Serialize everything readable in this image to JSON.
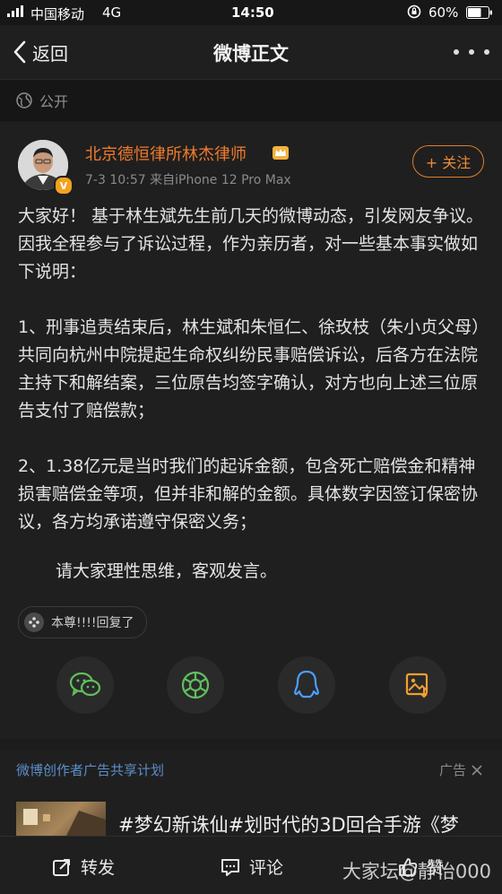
{
  "status": {
    "carrier": "中国移动",
    "network": "4G",
    "time": "14:50",
    "battery": "60%"
  },
  "nav": {
    "back_label": "返回",
    "title": "微博正文"
  },
  "visibility": {
    "label": "公开"
  },
  "post": {
    "author": "北京德恒律所林杰律师",
    "meta": "7-3 10:57  来自iPhone 12 Pro Max",
    "follow_label": "+ 关注",
    "paragraphs": [
      "大家好！ 基于林生斌先生前几天的微博动态，引发网友争议。因我全程参与了诉讼过程，作为亲历者，对一些基本事实做如下说明：",
      "1、刑事追责结束后，林生斌和朱恒仁、徐玫枝（朱小贞父母）共同向杭州中院提起生命权纠纷民事赔偿诉讼，后各方在法院主持下和解结案，三位原告均签字确认，对方也向上述三位原告支付了赔偿款；",
      "2、1.38亿元是当时我们的起诉金额，包含死亡赔偿金和精神损害赔偿金等项，但并非和解的金额。具体数字因签订保密协议，各方均承诺遵守保密义务；",
      "请大家理性思维，客观发言。"
    ],
    "reply_text": "本尊!!!!回复了"
  },
  "share": [
    "wechat-icon",
    "moments-icon",
    "qq-icon",
    "save-image-icon"
  ],
  "ad": {
    "plan_label": "微博创作者广告共享计划",
    "tag_label": "广告",
    "title": "#梦幻新诛仙#划时代的3D回合手游《梦"
  },
  "tabbar": {
    "repost": "转发",
    "comment": "评论",
    "like": "赞"
  },
  "watermark": "大家坛@静怡000",
  "colors": {
    "accent": "#f07b2b",
    "link_blue": "#5b8ec9",
    "background": "#1c1c1c"
  }
}
